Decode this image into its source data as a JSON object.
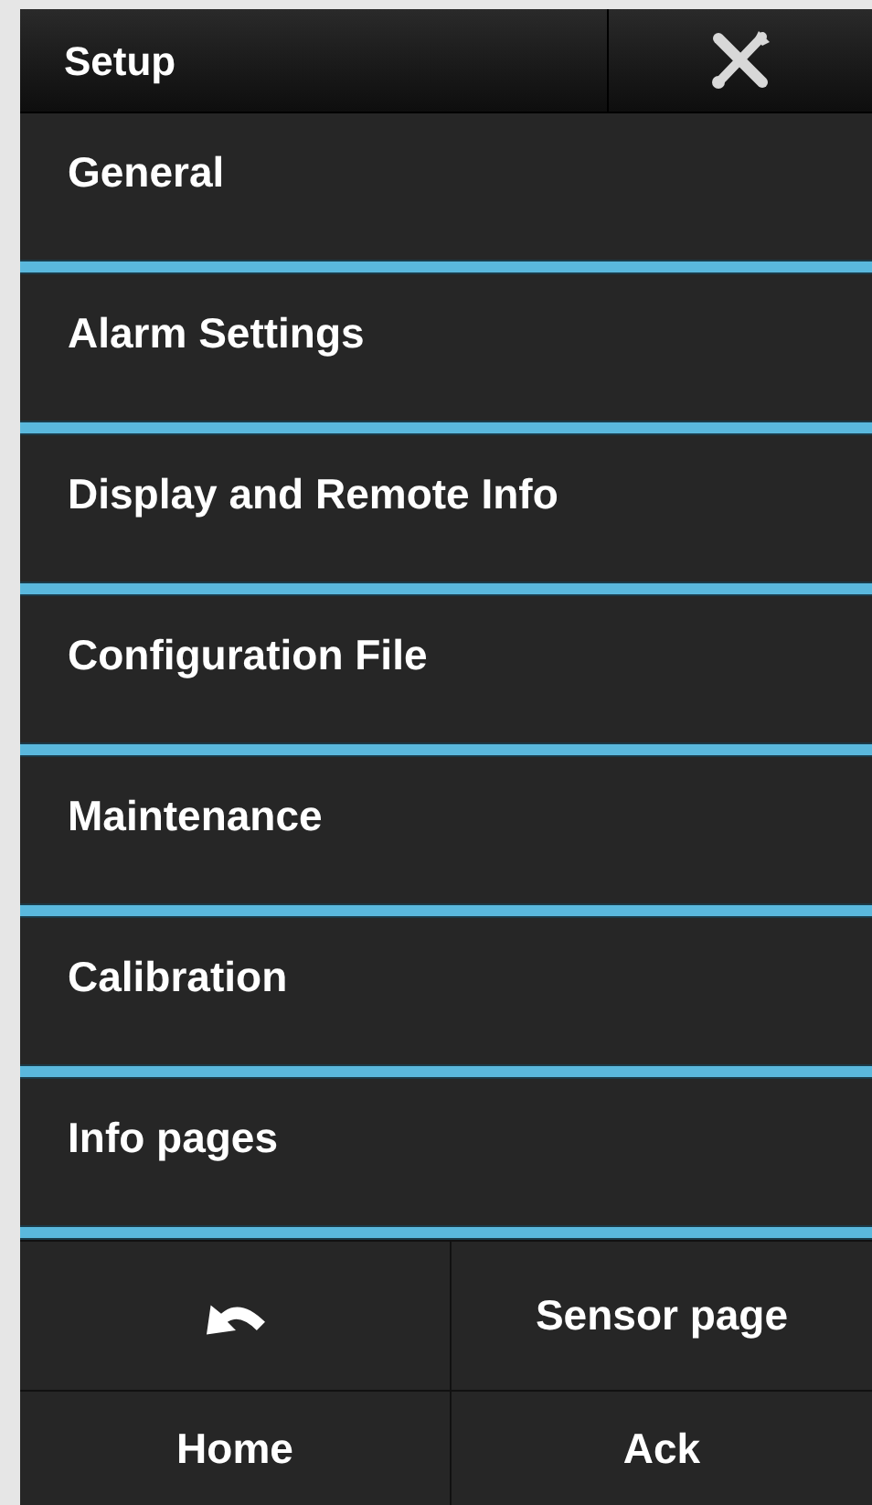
{
  "header": {
    "title": "Setup"
  },
  "menu_items": [
    {
      "label": "General"
    },
    {
      "label": "Alarm Settings"
    },
    {
      "label": "Display and Remote Info"
    },
    {
      "label": "Configuration File"
    },
    {
      "label": "Maintenance"
    },
    {
      "label": "Calibration"
    },
    {
      "label": "Info pages"
    }
  ],
  "bottom_buttons": [
    {
      "kind": "back"
    },
    {
      "kind": "text",
      "label": "Sensor page"
    },
    {
      "kind": "text",
      "label": "Home"
    },
    {
      "kind": "text",
      "label": "Ack"
    }
  ]
}
